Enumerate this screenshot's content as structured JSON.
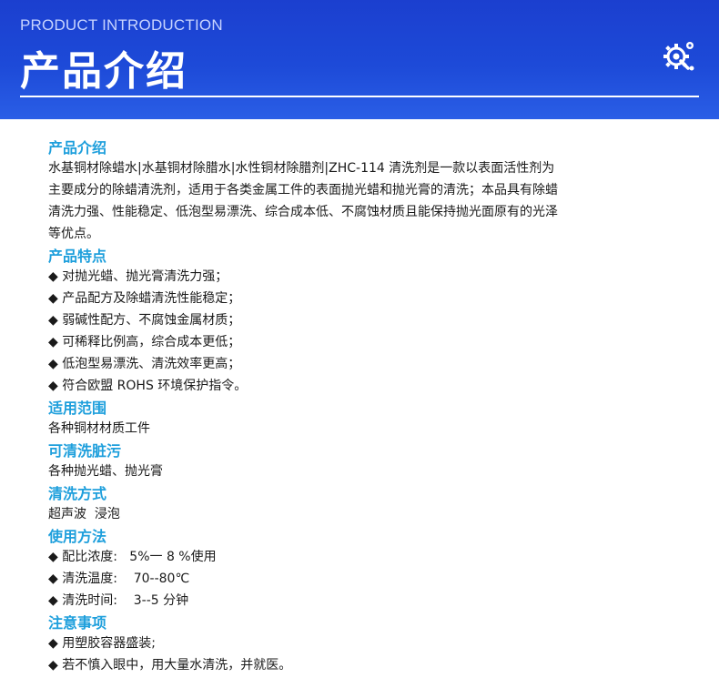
{
  "banner": {
    "subtitle": "PRODUCT INTRODUCTION",
    "title": "产品介绍",
    "icon": "gear-magnifier-icon"
  },
  "sections": [
    {
      "heading": "产品介绍",
      "paragraph_lines": [
        "水基铜材除蜡水|水基铜材除腊水|水性铜材除腊剂|ZHC-114 清洗剂是一款以表面活性剂为",
        "主要成分的除蜡清洗剂，适用于各类金属工件的表面抛光蜡和抛光膏的清洗；本品具有除蜡",
        "清洗力强、性能稳定、低泡型易漂洗、综合成本低、不腐蚀材质且能保持抛光面原有的光泽",
        "等优点。"
      ]
    },
    {
      "heading": "产品特点",
      "lines": [
        "◆ 对抛光蜡、抛光膏清洗力强；",
        "◆ 产品配方及除蜡清洗性能稳定；",
        "◆ 弱碱性配方、不腐蚀金属材质；",
        "◆ 可稀释比例高，综合成本更低；",
        "◆ 低泡型易漂洗、清洗效率更高；",
        "◆ 符合欧盟 ROHS 环境保护指令。"
      ]
    },
    {
      "heading": "适用范围",
      "lines": [
        "各种铜材材质工件"
      ]
    },
    {
      "heading": "可清洗脏污",
      "lines": [
        "各种抛光蜡、抛光膏"
      ]
    },
    {
      "heading": "清洗方式",
      "lines": [
        "超声波  浸泡"
      ]
    },
    {
      "heading": "使用方法",
      "lines": [
        "◆ 配比浓度:   5%一 8 %使用",
        "◆ 清洗温度:    70--80℃",
        "◆ 清洗时间:    3--5 分钟"
      ]
    },
    {
      "heading": "注意事项",
      "lines": [
        "◆ 用塑胶容器盛装;",
        "◆ 若不慎入眼中，用大量水清洗，并就医。"
      ]
    }
  ]
}
